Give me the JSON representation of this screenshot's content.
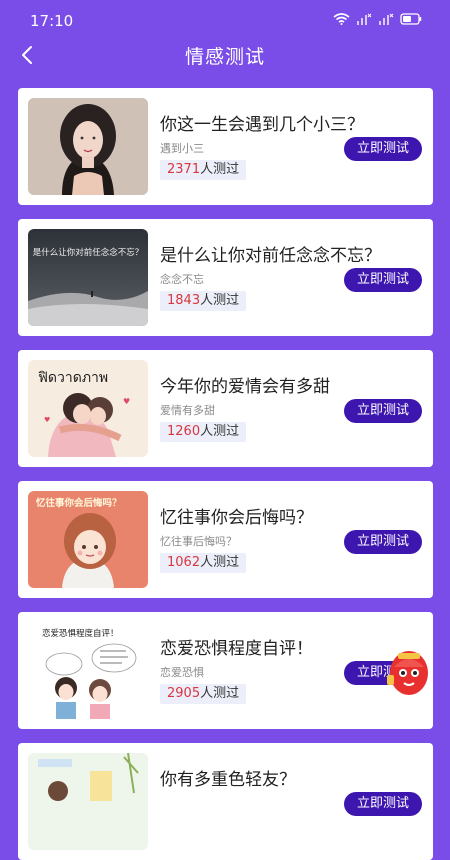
{
  "status": {
    "time": "17:10"
  },
  "header": {
    "title": "情感测试"
  },
  "labels": {
    "tested_suffix": "人测过"
  },
  "colors": {
    "background": "#7b4de8",
    "button": "#3d16b0",
    "count_number": "#d9363e"
  },
  "tests": [
    {
      "title": "你这一生会遇到几个小三？",
      "subtitle": "遇到小三",
      "count": "2371",
      "button": "立即测试",
      "image": "portrait-photo"
    },
    {
      "title": "是什么让你对前任念念不忘？",
      "subtitle": "念念不忘",
      "count": "1843",
      "button": "立即测试",
      "image": "desert-night-scene",
      "image_text": "是什么让你对前任念念不忘？"
    },
    {
      "title": "今年你的爱情会有多甜",
      "subtitle": "爱情有多甜",
      "count": "1260",
      "button": "立即测试",
      "image": "hugging-couple-illustration",
      "image_text": "ฟิดวาดภาพ"
    },
    {
      "title": "忆往事你会后悔吗？",
      "subtitle": "忆往事后悔吗？",
      "count": "1062",
      "button": "立即测试",
      "image": "cartoon-girl-illustration",
      "image_text": "忆往事你会后悔吗？"
    },
    {
      "title": "恋爱恐惧程度自评！",
      "subtitle": "恋爱恐惧",
      "count": "2905",
      "button": "立即测试",
      "image": "comic-couple-illustration",
      "image_text": "恋爱恐惧程度自评！"
    },
    {
      "title": "你有多重色轻友？",
      "subtitle": "",
      "count": "",
      "button": "立即测试",
      "image": "cartoon-illustration"
    }
  ]
}
